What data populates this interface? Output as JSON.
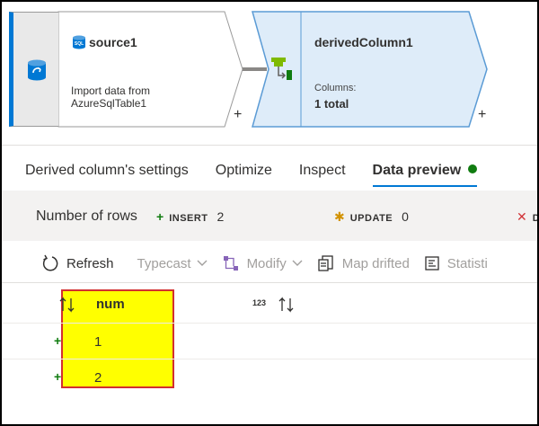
{
  "pipeline": {
    "source_node": {
      "title": "source1",
      "description": "Import data from AzureSqlTable1",
      "add_label": "+"
    },
    "derived_node": {
      "title": "derivedColumn1",
      "columns_label": "Columns:",
      "columns_value": "1 total",
      "add_label": "+"
    }
  },
  "tabs": [
    {
      "label": "Derived column's settings"
    },
    {
      "label": "Optimize"
    },
    {
      "label": "Inspect"
    },
    {
      "label": "Data preview",
      "active": true
    }
  ],
  "stats": {
    "label": "Number of rows",
    "insert": {
      "symbol": "+",
      "keyword": "INSERT",
      "value": "2"
    },
    "update": {
      "symbol": "✱",
      "keyword": "UPDATE",
      "value": "0"
    },
    "delete": {
      "symbol": "✕",
      "keyword": "D"
    }
  },
  "toolbar": {
    "refresh": "Refresh",
    "typecast": "Typecast",
    "modify": "Modify",
    "map_drifted": "Map drifted",
    "statistics": "Statisti"
  },
  "grid": {
    "columns": [
      {
        "name": "num",
        "type": "123"
      }
    ],
    "rows": [
      {
        "marker": "+",
        "value": "1"
      },
      {
        "marker": "+",
        "value": "2"
      }
    ]
  },
  "colors": {
    "accent": "#0078d4",
    "insert": "#107c10",
    "update": "#d29200",
    "delete": "#d13438",
    "highlight": "#ffff00",
    "highlight_border": "#d32f2f"
  }
}
